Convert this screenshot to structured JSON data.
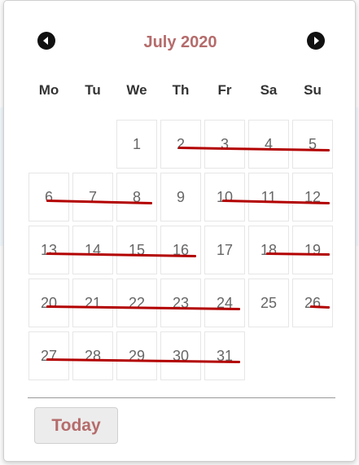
{
  "calendar": {
    "month_title": "July 2020",
    "prev_icon": "chevron-left-icon",
    "next_icon": "chevron-right-icon",
    "weekdays": [
      "Mo",
      "Tu",
      "We",
      "Th",
      "Fr",
      "Sa",
      "Su"
    ],
    "first_weekday_index": 2,
    "days_in_month": 31,
    "days": [
      "1",
      "2",
      "3",
      "4",
      "5",
      "6",
      "7",
      "8",
      "9",
      "10",
      "11",
      "12",
      "13",
      "14",
      "15",
      "16",
      "17",
      "18",
      "19",
      "20",
      "21",
      "22",
      "23",
      "24",
      "25",
      "26",
      "27",
      "28",
      "29",
      "30",
      "31"
    ],
    "struck_days": [
      2,
      3,
      4,
      5,
      6,
      7,
      8,
      10,
      11,
      12,
      13,
      14,
      15,
      16,
      18,
      19,
      20,
      21,
      22,
      23,
      24,
      26,
      27,
      28,
      29,
      30,
      31
    ],
    "available_days": [
      1,
      9,
      17,
      25
    ],
    "today_label": "Today",
    "colors": {
      "title": "#b56b6b",
      "strike": "#b30000",
      "day_text": "#666666"
    }
  }
}
